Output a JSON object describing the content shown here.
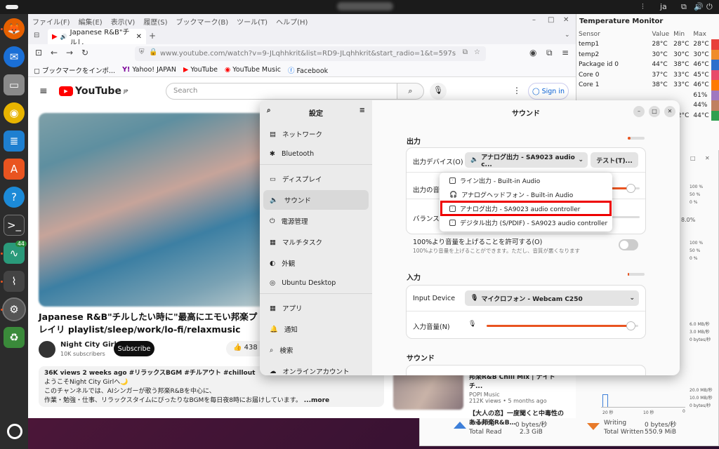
{
  "topbar": {
    "lang": "ja",
    "icons": [
      "network-icon",
      "volume-icon",
      "power-icon"
    ]
  },
  "firefox": {
    "menus": [
      "ファイル(F)",
      "編集(E)",
      "表示(V)",
      "履歴(S)",
      "ブックマーク(B)",
      "ツール(T)",
      "ヘルプ(H)"
    ],
    "tab_title": "Japanese R&B\"チルし",
    "url": "www.youtube.com/watch?v=9-JLqhhkrit&list=RD9-JLqhhkrit&start_radio=1&t=597s",
    "bookmarks": [
      "ブックマークをインポ...",
      "Yahoo! JAPAN",
      "YouTube",
      "YouTube Music",
      "Facebook"
    ]
  },
  "youtube": {
    "logo": "YouTube",
    "logo_sup": "JP",
    "search_placeholder": "Search",
    "signin": "Sign in",
    "video_title": "Japanese R&B\"チルしたい時に\"最高にエモい邦楽プレイリ playlist/sleep/work/lo-fi/relaxmusic",
    "channel": "Night City Girl",
    "subscribers": "10K subscribers",
    "subscribe": "Subscribe",
    "likes": "438",
    "desc_stats": "36K views  2 weeks ago  #リラックスBGM #チルアウト #chillout",
    "desc_line1": "ようこそNight City Girlへ🌙",
    "desc_line2": "このチャンネルでは、AIシンガーが歌う邦楽R&Bを中心に、",
    "desc_line3": "作業・勉強・仕事、リラックスタイムにぴったりなBGMを毎日夜8時にお届けしています。",
    "desc_more": "...more",
    "rec": [
      {
        "title": "邦楽R&B Chill Mix | ナイトチ...",
        "channel": "POPI Music",
        "meta": "212K views • 5 months ago"
      },
      {
        "title": "【大人の恋】一度聞くと中毒性のある邦楽R&B…"
      }
    ]
  },
  "temp_monitor": {
    "title": "Temperature Monitor",
    "headers": [
      "Sensor",
      "Value",
      "Min",
      "Max"
    ],
    "rows": [
      {
        "sensor": "temp1",
        "value": "28°C",
        "min": "28°C",
        "max": "28°C",
        "color": "#e8403a"
      },
      {
        "sensor": "temp2",
        "value": "30°C",
        "min": "30°C",
        "max": "30°C",
        "color": "#f08c2a"
      },
      {
        "sensor": "Package id 0",
        "value": "44°C",
        "min": "38°C",
        "max": "46°C",
        "color": "#2d6fcc"
      },
      {
        "sensor": "Core 0",
        "value": "37°C",
        "min": "33°C",
        "max": "45°C",
        "color": "#e84a6a"
      },
      {
        "sensor": "Core 1",
        "value": "38°C",
        "min": "33°C",
        "max": "46°C",
        "color": "#ff7a00"
      },
      {
        "sensor": "",
        "value": "",
        "min": "",
        "max": "61%",
        "color": "#a078c0"
      },
      {
        "sensor": "",
        "value": "",
        "min": "",
        "max": "44%",
        "color": "#c08060"
      },
      {
        "sensor": "",
        "value": "",
        "min": "42°C",
        "max": "44°C",
        "color": "#30a050"
      }
    ]
  },
  "system_monitor": {
    "cpu_labels": [
      "100 %",
      "50 %",
      "0 %"
    ],
    "percent": "8.0%",
    "mem_labels": [
      "100 %",
      "50 %",
      "0 %"
    ],
    "net_labels": [
      "6.0 MB/秒",
      "3.0 MB/秒",
      "0 bytes/秒"
    ],
    "disk_labels": [
      "20.0 MB/秒",
      "10.0 MB/秒",
      "0 bytes/秒"
    ],
    "time_labels": [
      "20 秒",
      "10 秒",
      "0"
    ],
    "reading_label": "Reading",
    "reading_value": "0 bytes/秒",
    "total_read_label": "Total Read",
    "total_read_value": "2.3 GiB",
    "writing_label": "Writing",
    "writing_value": "0 bytes/秒",
    "total_written_label": "Total Written",
    "total_written_value": "550.9 MiB"
  },
  "settings": {
    "sidebar_title": "設定",
    "main_title": "サウンド",
    "sidebar": [
      {
        "label": "ネットワーク",
        "icon": "network-icon"
      },
      {
        "label": "Bluetooth",
        "icon": "bluetooth-icon"
      },
      {
        "label": "ディスプレイ",
        "icon": "display-icon"
      },
      {
        "label": "サウンド",
        "icon": "sound-icon"
      },
      {
        "label": "電源管理",
        "icon": "power-icon"
      },
      {
        "label": "マルチタスク",
        "icon": "multitask-icon"
      },
      {
        "label": "外観",
        "icon": "appearance-icon"
      },
      {
        "label": "Ubuntu Desktop",
        "icon": "ubuntu-desktop-icon"
      },
      {
        "label": "アプリ",
        "icon": "apps-icon"
      },
      {
        "label": "通知",
        "icon": "bell-icon"
      },
      {
        "label": "検索",
        "icon": "search-icon"
      },
      {
        "label": "オンラインアカウント",
        "icon": "cloud-icon"
      }
    ],
    "output_section": "出力",
    "output_device_label": "出力デバイス(O)",
    "output_device_value": "アナログ出力 - SA9023 audio c...",
    "test_button": "テスト(T)...",
    "output_volume_label": "出力の音量",
    "output_volume": 0.95,
    "balance_label": "バランス",
    "overamp_label": "100%より音量を上げることを許可する(O)",
    "overamp_desc": "100%より音量を上げることができます。ただし、音質が悪くなります",
    "input_section": "入力",
    "input_device_label": "Input Device",
    "input_device_value": "マイクロフォン - Webcam C250",
    "input_volume_label": "入力音量(N)",
    "input_volume": 0.95,
    "sound_section": "サウンド",
    "dropdown_options": [
      {
        "label": "ライン出力 - Built-in Audio",
        "icon": "speaker-icon"
      },
      {
        "label": "アナログヘッドフォン - Built-in Audio",
        "icon": "headphones-icon"
      },
      {
        "label": "アナログ出力 - SA9023 audio controller",
        "icon": "speaker-icon"
      },
      {
        "label": "デジタル出力 (S/PDIF) - SA9023 audio controller",
        "icon": "speaker-icon"
      }
    ]
  },
  "dock": [
    {
      "name": "firefox",
      "badge": ""
    },
    {
      "name": "thunderbird",
      "badge": ""
    },
    {
      "name": "files",
      "badge": ""
    },
    {
      "name": "rhythmbox",
      "badge": ""
    },
    {
      "name": "writer",
      "badge": ""
    },
    {
      "name": "app-center",
      "badge": ""
    },
    {
      "name": "help",
      "badge": ""
    },
    {
      "name": "terminal",
      "badge": ""
    },
    {
      "name": "sensor-indicator",
      "badge": "44"
    },
    {
      "name": "system-monitor",
      "badge": ""
    },
    {
      "name": "settings",
      "badge": ""
    },
    {
      "name": "trash",
      "badge": ""
    }
  ]
}
